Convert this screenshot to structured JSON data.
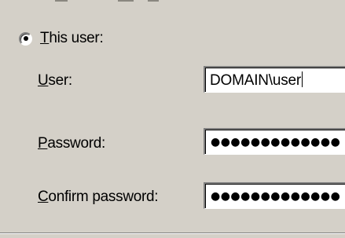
{
  "radio": {
    "label_accel": "T",
    "label_rest": "his user:",
    "checked": true
  },
  "fields": {
    "user": {
      "label_accel": "U",
      "label_rest": "ser:",
      "value": "DOMAIN\\user"
    },
    "password": {
      "label_accel": "P",
      "label_rest": "assword:",
      "masked_value": "●●●●●●●●●●●●●"
    },
    "confirm_password": {
      "label_accel": "C",
      "label_rest": "onfirm password:",
      "masked_value": "●●●●●●●●●●●●●"
    }
  }
}
